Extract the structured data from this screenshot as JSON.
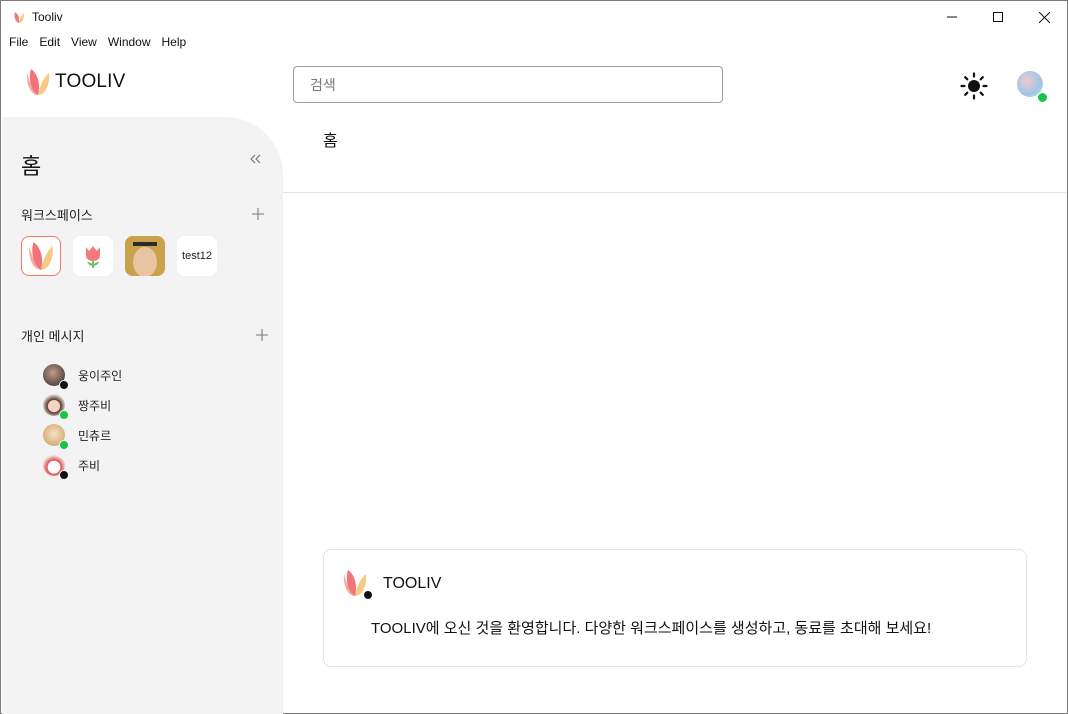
{
  "window": {
    "title": "Tooliv",
    "controls": [
      "minimize",
      "maximize",
      "close"
    ]
  },
  "menubar": {
    "items": [
      "File",
      "Edit",
      "View",
      "Window",
      "Help"
    ]
  },
  "header": {
    "logo_text": "TOOLIV",
    "search_placeholder": "검색",
    "theme_icon": "sun-icon",
    "profile_status": "online"
  },
  "sidebar": {
    "title": "홈",
    "collapse_icon": "double-chevron-left-icon",
    "workspaces_label": "워크스페이스",
    "workspaces": [
      {
        "type": "logo",
        "label": "",
        "active": true
      },
      {
        "type": "tulip",
        "label": "",
        "active": false
      },
      {
        "type": "photo",
        "label": "",
        "active": false
      },
      {
        "type": "text",
        "label": "test12",
        "active": false
      }
    ],
    "dm_label": "개인 메시지",
    "dms": [
      {
        "name": "웅이주인",
        "status": "offline"
      },
      {
        "name": "짱주비",
        "status": "online"
      },
      {
        "name": "민츄르",
        "status": "online"
      },
      {
        "name": "주비",
        "status": "offline"
      }
    ]
  },
  "main": {
    "title": "홈",
    "welcome": {
      "sender": "TOOLIV",
      "message": "TOOLIV에 오신 것을 환영합니다. 다양한 워크스페이스를 생성하고, 동료를 초대해 보세요!"
    }
  },
  "colors": {
    "accent": "#f27a5e",
    "online": "#19c44a",
    "sidebar_bg": "#f3f3f3"
  }
}
